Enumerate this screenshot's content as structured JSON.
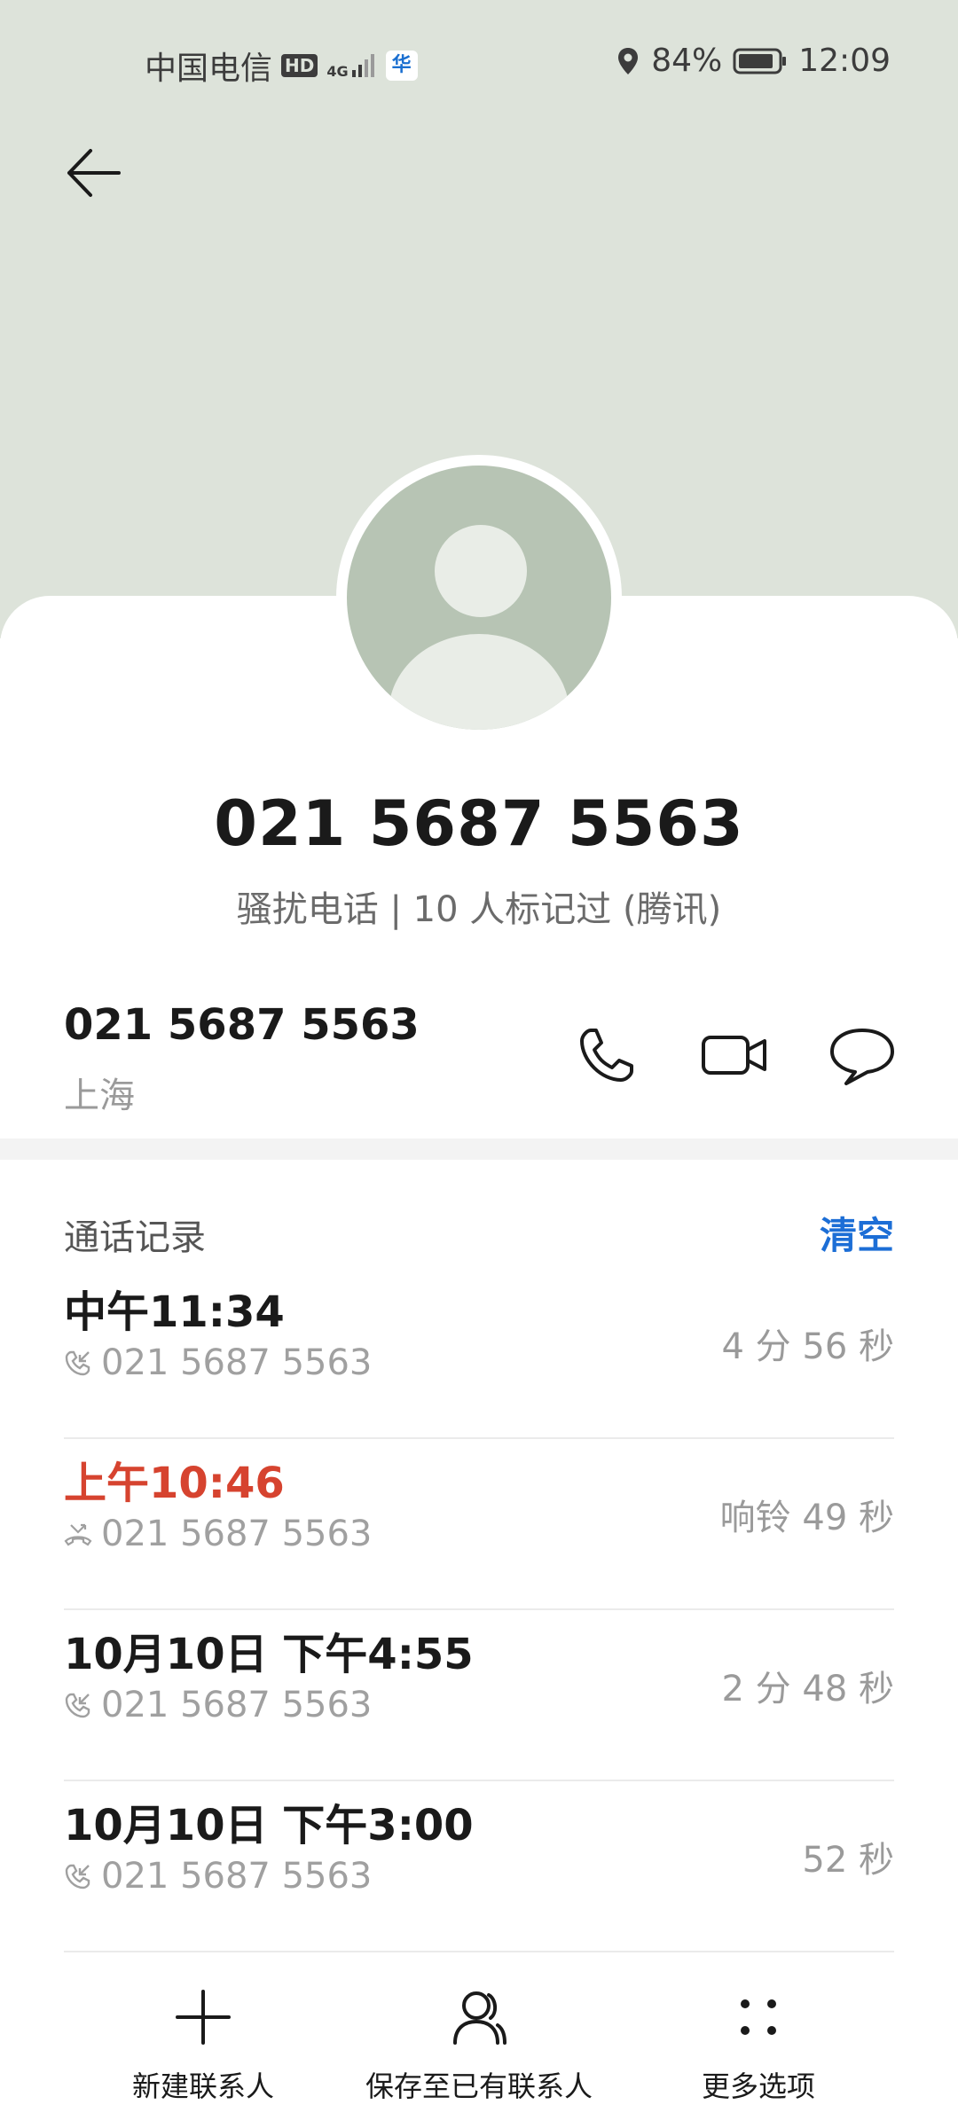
{
  "status_bar": {
    "carrier": "中国电信",
    "hd": "HD",
    "network": "4G",
    "app_badge": "华",
    "battery": "84%",
    "time": "12:09"
  },
  "contact": {
    "number": "021 5687 5563",
    "tag": "骚扰电话 | 10 人标记过 (腾讯)",
    "row_number": "021 5687 5563",
    "location": "上海"
  },
  "call_log": {
    "title": "通话记录",
    "clear_label": "清空",
    "items": [
      {
        "time": "中午11:34",
        "number": "021 5687 5563",
        "duration": "4 分 56 秒",
        "missed": false
      },
      {
        "time": "上午10:46",
        "number": "021 5687 5563",
        "duration": "响铃 49 秒",
        "missed": true
      },
      {
        "time": "10月10日 下午4:55",
        "number": "021 5687 5563",
        "duration": "2 分 48 秒",
        "missed": false
      },
      {
        "time": "10月10日 下午3:00",
        "number": "021 5687 5563",
        "duration": "52 秒",
        "missed": false
      }
    ]
  },
  "bottom_bar": {
    "new_contact": "新建联系人",
    "save_existing": "保存至已有联系人",
    "more_options": "更多选项"
  },
  "colors": {
    "hero_bg": "#dde3da",
    "accent_blue": "#1c6ed6",
    "missed_red": "#d6432f",
    "avatar_bg": "#b7c4b4"
  }
}
